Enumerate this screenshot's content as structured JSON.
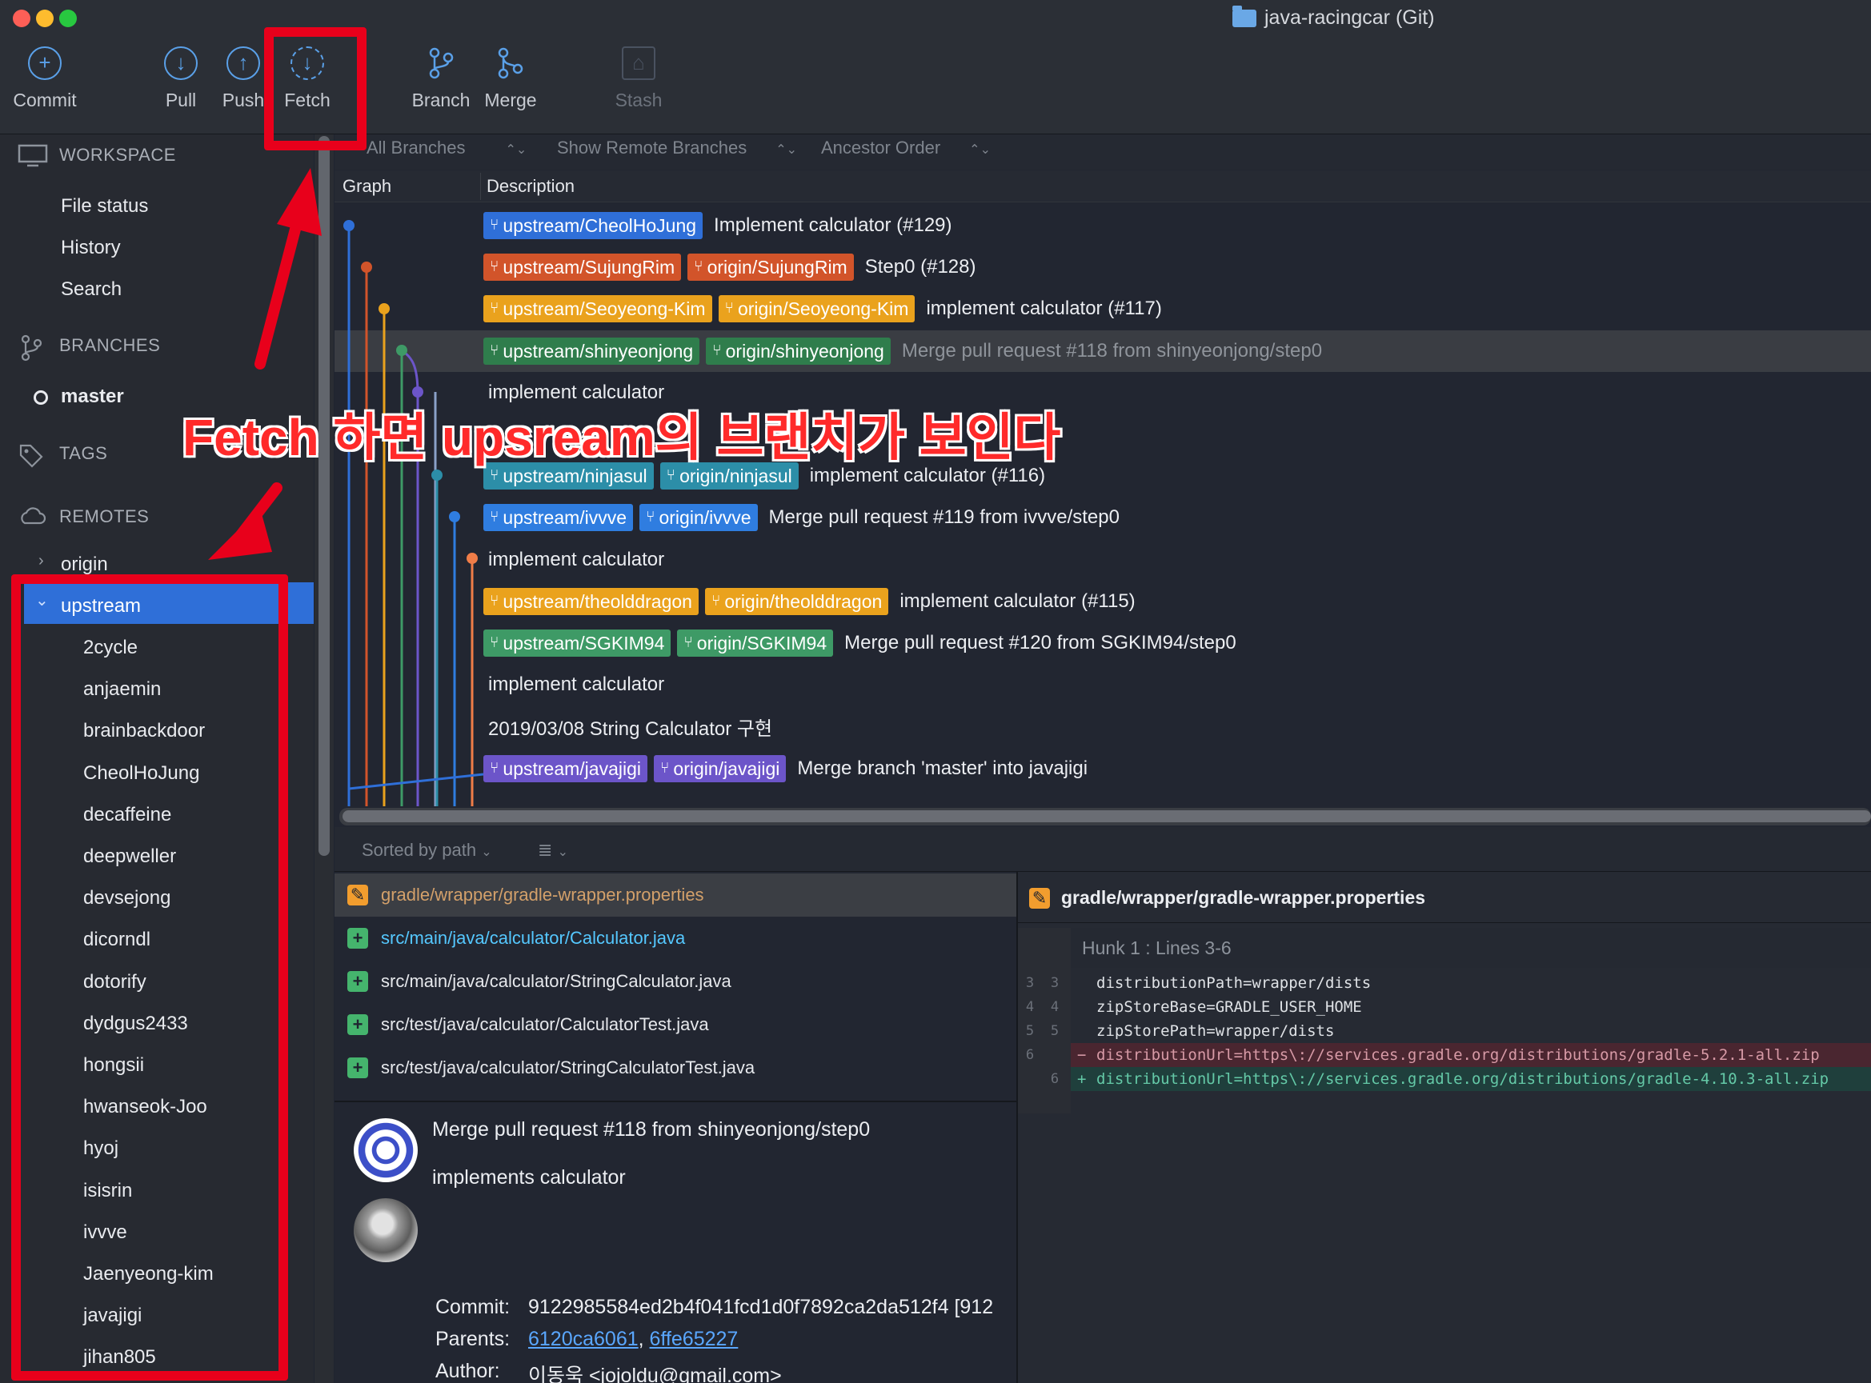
{
  "window": {
    "title": "java-racingcar (Git)"
  },
  "toolbar": {
    "commit": "Commit",
    "pull": "Pull",
    "push": "Push",
    "fetch": "Fetch",
    "branch": "Branch",
    "merge": "Merge",
    "stash": "Stash"
  },
  "sidebar": {
    "workspace": "WORKSPACE",
    "file_status": "File status",
    "history": "History",
    "search": "Search",
    "branches": "BRANCHES",
    "current_branch": "master",
    "tags": "TAGS",
    "remotes": "REMOTES",
    "origin": "origin",
    "upstream": "upstream",
    "upstream_branches": [
      "2cycle",
      "anjaemin",
      "brainbackdoor",
      "CheolHoJung",
      "decaffeine",
      "deepweller",
      "devsejong",
      "dicorndl",
      "dotorify",
      "dydgus2433",
      "hongsii",
      "hwanseok-Joo",
      "hyoj",
      "isisrin",
      "ivvve",
      "Jaenyeong-kim",
      "javajigi",
      "jihan805"
    ]
  },
  "filters": {
    "branches": "All Branches",
    "remote": "Show Remote Branches",
    "order": "Ancestor Order"
  },
  "columns": {
    "graph": "Graph",
    "description": "Description"
  },
  "commits": [
    {
      "tags": [
        "upstream/CheolHoJung"
      ],
      "message": "Implement calculator (#129)"
    },
    {
      "tags": [
        "upstream/SujungRim",
        "origin/SujungRim"
      ],
      "message": "Step0 (#128)"
    },
    {
      "tags": [
        "upstream/Seoyeong-Kim",
        "origin/Seoyeong-Kim"
      ],
      "message": "implement calculator (#117)"
    },
    {
      "tags": [
        "upstream/shinyeonjong",
        "origin/shinyeonjong"
      ],
      "message": "Merge pull request #118 from shinyeonjong/step0"
    },
    {
      "tags": [],
      "message": "implement calculator"
    },
    {
      "tags": [],
      "message": ""
    },
    {
      "tags": [
        "upstream/ninjasul",
        "origin/ninjasul"
      ],
      "message": "implement calculator (#116)"
    },
    {
      "tags": [
        "upstream/ivvve",
        "origin/ivvve"
      ],
      "message": "Merge pull request #119 from ivvve/step0"
    },
    {
      "tags": [],
      "message": "implement calculator"
    },
    {
      "tags": [
        "upstream/theolddragon",
        "origin/theolddragon"
      ],
      "message": "implement calculator (#115)"
    },
    {
      "tags": [
        "upstream/SGKIM94",
        "origin/SGKIM94"
      ],
      "message": "Merge pull request #120 from SGKIM94/step0"
    },
    {
      "tags": [],
      "message": "implement calculator"
    },
    {
      "tags": [],
      "message": "2019/03/08 String Calculator 구현"
    },
    {
      "tags": [
        "upstream/javajigi",
        "origin/javajigi"
      ],
      "message": "Merge branch 'master' into javajigi"
    }
  ],
  "colors": {
    "tag_blue": "#2f6fd8",
    "tag_orange": "#d2542a",
    "tag_yellow": "#eaa21d",
    "tag_green": "#2f7d4c",
    "tag_teal": "#2c8ea8",
    "tag_lightblue": "#2f7de0",
    "tag_lightgreen": "#3e9a66",
    "tag_purple": "#6c55c9",
    "annotation_red": "#e8001b"
  },
  "files": {
    "sort_label": "Sorted by path",
    "items": [
      {
        "status": "modified",
        "path": "gradle/wrapper/gradle-wrapper.properties"
      },
      {
        "status": "added",
        "path": "src/main/java/calculator/Calculator.java"
      },
      {
        "status": "added",
        "path": "src/main/java/calculator/StringCalculator.java"
      },
      {
        "status": "added",
        "path": "src/test/java/calculator/CalculatorTest.java"
      },
      {
        "status": "added",
        "path": "src/test/java/calculator/StringCalculatorTest.java"
      }
    ]
  },
  "diff": {
    "file": "gradle/wrapper/gradle-wrapper.properties",
    "hunk": "Hunk 1 : Lines 3-6",
    "lines": [
      {
        "old": "3",
        "new": "3",
        "type": "ctx",
        "text": "distributionPath=wrapper/dists"
      },
      {
        "old": "4",
        "new": "4",
        "type": "ctx",
        "text": "zipStoreBase=GRADLE_USER_HOME"
      },
      {
        "old": "5",
        "new": "5",
        "type": "ctx",
        "text": "zipStorePath=wrapper/dists"
      },
      {
        "old": "6",
        "new": "",
        "type": "del",
        "text": "distributionUrl=https\\://services.gradle.org/distributions/gradle-5.2.1-all.zip"
      },
      {
        "old": "",
        "new": "6",
        "type": "add",
        "text": "distributionUrl=https\\://services.gradle.org/distributions/gradle-4.10.3-all.zip"
      }
    ]
  },
  "commit_detail": {
    "title": "Merge pull request #118 from shinyeonjong/step0",
    "body": "implements calculator",
    "commit_label": "Commit:",
    "commit_value": "9122985584ed2b4f041fcd1d0f7892ca2da512f4 [912",
    "parents_label": "Parents:",
    "parent1": "6120ca6061",
    "parent_sep": ",",
    "parent2": "6ffe65227",
    "author_label": "Author:",
    "author_value": "이동욱 <jojoldu@gmail.com>"
  },
  "annotation": {
    "text": "Fetch 하면 upsream의 브랜치가 보인다"
  }
}
